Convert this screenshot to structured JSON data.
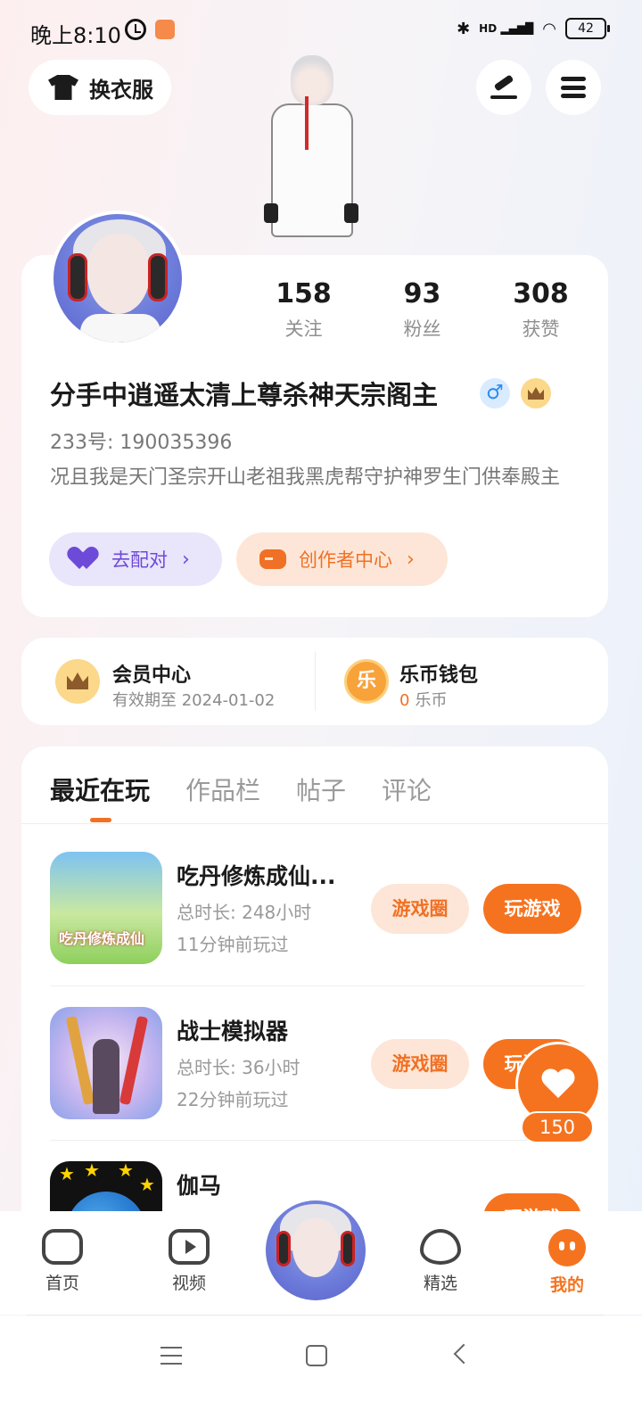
{
  "status_bar": {
    "time": "晚上8:10",
    "network": "HD",
    "battery": "42"
  },
  "top": {
    "outfit_label": "换衣服"
  },
  "profile": {
    "stats": [
      {
        "value": "158",
        "label": "关注"
      },
      {
        "value": "93",
        "label": "粉丝"
      },
      {
        "value": "308",
        "label": "获赞"
      }
    ],
    "username": "分手中逍遥太清上尊杀神天宗阁主",
    "gender_symbol": "♂",
    "id_label": "233号: 190035396",
    "bio": "况且我是天门圣宗开山老祖我黑虎帮守护神罗生门供奉殿主",
    "pair_label": "去配对",
    "creator_label": "创作者中心",
    "chevron": "›"
  },
  "membership": {
    "vip_title": "会员中心",
    "vip_sub": "有效期至 2024-01-02",
    "wallet_title": "乐币钱包",
    "wallet_icon_text": "乐",
    "wallet_amount": "0",
    "wallet_unit": "乐币"
  },
  "tabs": [
    "最近在玩",
    "作品栏",
    "帖子",
    "评论"
  ],
  "games": [
    {
      "name": "吃丹修炼成仙...",
      "duration": "总时长: 248小时",
      "last_played": "11分钟前玩过",
      "thumb_text": "吃丹修炼成仙"
    },
    {
      "name": "战士模拟器",
      "duration": "总时长: 36小时",
      "last_played": "22分钟前玩过"
    },
    {
      "name": "伽马",
      "duration": "",
      "last_played": ""
    }
  ],
  "game_buttons": {
    "circle": "游戏圈",
    "play": "玩游戏"
  },
  "like_fab": {
    "count": "150"
  },
  "bottom_nav": [
    {
      "label": "首页",
      "icon": "gamepad-icon"
    },
    {
      "label": "视频",
      "icon": "video-icon"
    },
    {
      "label": "精选",
      "icon": "heart-outline-icon"
    },
    {
      "label": "我的",
      "icon": "face-icon"
    }
  ],
  "colors": {
    "accent": "#f5731f",
    "purple": "#6e4ad8"
  }
}
